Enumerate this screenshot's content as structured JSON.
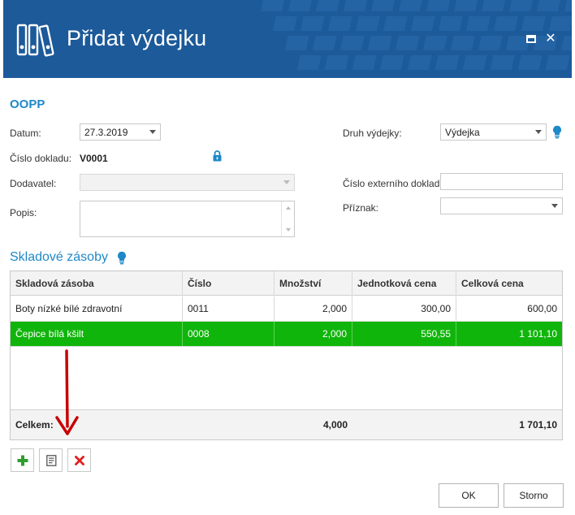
{
  "window": {
    "title": "Přidat výdejku"
  },
  "form": {
    "section_title": "OOPP",
    "datum": {
      "label": "Datum:",
      "value": "27.3.2019"
    },
    "cislo_dokladu": {
      "label": "Číslo dokladu:",
      "value": "V0001"
    },
    "dodavatel": {
      "label": "Dodavatel:",
      "value": ""
    },
    "popis": {
      "label": "Popis:",
      "value": ""
    },
    "druh_vydejky": {
      "label": "Druh výdejky:",
      "value": "Výdejka"
    },
    "cislo_externiho": {
      "label": "Číslo externího dokladu:",
      "value": ""
    },
    "priznak": {
      "label": "Příznak:",
      "value": ""
    }
  },
  "stock": {
    "title": "Skladové zásoby",
    "columns": [
      "Skladová zásoba",
      "Číslo",
      "Množství",
      "Jednotková cena",
      "Celková cena"
    ],
    "rows": [
      {
        "item": "Boty nízké bílé zdravotní",
        "number": "0011",
        "qty": "2,000",
        "unit_price": "300,00",
        "total": "600,00",
        "selected": false
      },
      {
        "item": "Čepice bílá kšilt",
        "number": "0008",
        "qty": "2,000",
        "unit_price": "550,55",
        "total": "1 101,10",
        "selected": true
      }
    ],
    "footer": {
      "label": "Celkem:",
      "qty": "4,000",
      "total": "1 701,10"
    }
  },
  "buttons": {
    "ok": "OK",
    "cancel": "Storno"
  },
  "icons": {
    "add": "plus-icon",
    "edit": "document-edit-icon",
    "delete": "delete-x-icon",
    "hint": "lightbulb-icon",
    "lock": "lock-icon"
  },
  "colors": {
    "titlebar": "#1c5a9a",
    "accent": "#1e88c8",
    "selected_row": "#10b50b",
    "add": "#2e9e2e",
    "delete": "#e02020",
    "annotation_arrow": "#c80000"
  }
}
